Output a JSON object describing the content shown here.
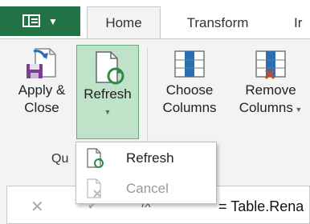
{
  "tabs": {
    "home": "Home",
    "transform": "Transform",
    "partial": "Ir"
  },
  "ribbon": {
    "apply_close": {
      "line1": "Apply &",
      "line2": "Close"
    },
    "refresh": {
      "label": "Refresh"
    },
    "choose_columns": {
      "line1": "Choose",
      "line2": "Columns"
    },
    "remove_columns": {
      "line1": "Remove",
      "line2": "Columns"
    },
    "group_label_partial": "Qu"
  },
  "dropdown_menu": {
    "items": [
      {
        "label": "Refresh",
        "enabled": true
      },
      {
        "label": "Cancel",
        "enabled": false
      }
    ]
  },
  "formula_bar": {
    "cancel": "✕",
    "confirm": "✓",
    "fx": "fx",
    "text": "= Table.Rena"
  },
  "colors": {
    "file_tab": "#217346",
    "refresh_highlight": "#bfe3c8",
    "refresh_border": "#6aab78"
  }
}
